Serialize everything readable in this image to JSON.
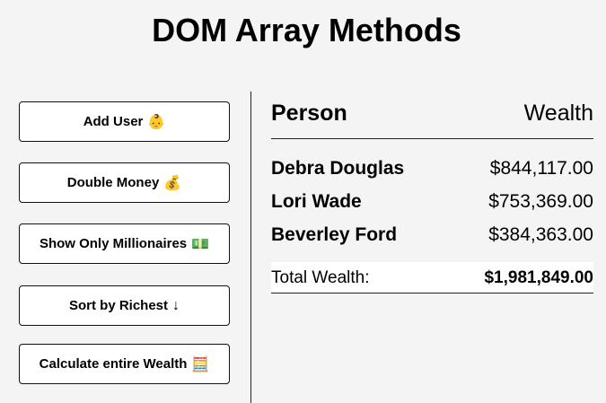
{
  "page": {
    "title": "DOM Array Methods"
  },
  "sidebar": {
    "buttons": [
      {
        "label": "Add User",
        "icon": "👶"
      },
      {
        "label": "Double Money",
        "icon": "💰"
      },
      {
        "label": "Show Only Millionaires",
        "icon": "💵"
      },
      {
        "label": "Sort by Richest",
        "icon": "↓"
      },
      {
        "label": "Calculate entire Wealth",
        "icon": "🧮"
      }
    ]
  },
  "main": {
    "header": {
      "person": "Person",
      "wealth": "Wealth"
    },
    "people": [
      {
        "name": "Debra Douglas",
        "money": "$844,117.00"
      },
      {
        "name": "Lori Wade",
        "money": "$753,369.00"
      },
      {
        "name": "Beverley Ford",
        "money": "$384,363.00"
      }
    ],
    "total": {
      "label": "Total Wealth:",
      "value": "$1,981,849.00"
    }
  }
}
